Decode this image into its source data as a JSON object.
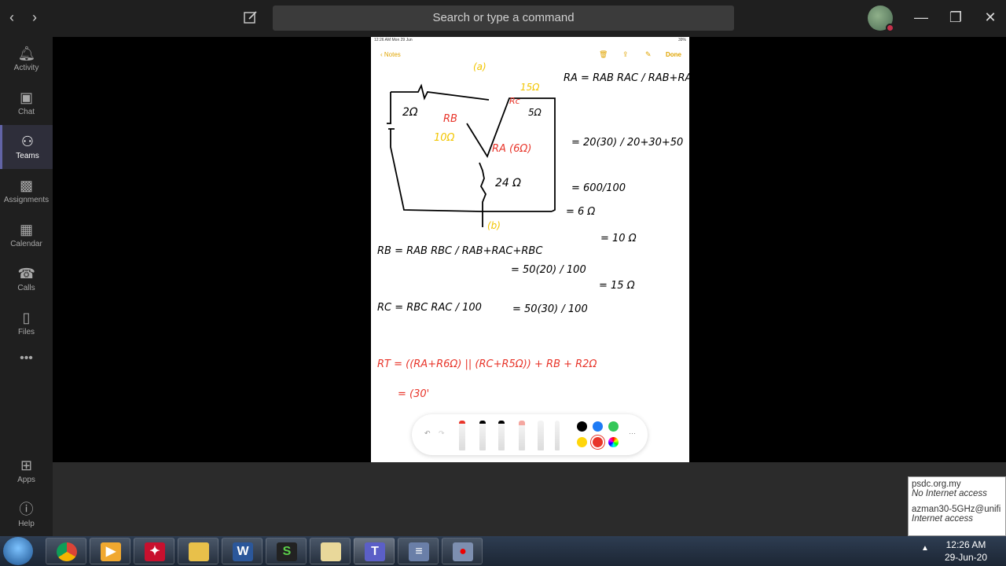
{
  "titlebar": {
    "back_icon": "chevron-left-icon",
    "forward_icon": "chevron-right-icon",
    "search_placeholder": "Search or type a command",
    "minimize": "—",
    "restore": "❐",
    "close": "✕"
  },
  "rail": {
    "items": [
      {
        "label": "Activity",
        "icon": "bell-icon"
      },
      {
        "label": "Chat",
        "icon": "chat-icon"
      },
      {
        "label": "Teams",
        "icon": "teams-icon",
        "active": true
      },
      {
        "label": "Assignments",
        "icon": "bag-icon"
      },
      {
        "label": "Calendar",
        "icon": "calendar-icon"
      },
      {
        "label": "Calls",
        "icon": "phone-icon"
      },
      {
        "label": "Files",
        "icon": "file-icon"
      },
      {
        "label": "•••",
        "icon": "more-icon"
      },
      {
        "label": "Apps",
        "icon": "apps-icon"
      },
      {
        "label": "Help",
        "icon": "help-icon"
      }
    ]
  },
  "ipad": {
    "status_time": "12:26 AM   Mon 29 Jun",
    "status_battery": "39%",
    "back_label": "Notes",
    "done_label": "Done",
    "notes": {
      "ra_formula": "RA = RAB RAC / RAB+RAC+RBC",
      "ra_step1": "= 20(30) / 20+30+50",
      "ra_step2": "= 600/100",
      "ra_result": "= 6 Ω",
      "rb_formula": "RB = RAB RBC / RAB+RAC+RBC",
      "rb_step": "= 50(20) / 100",
      "rb_result": "= 10 Ω",
      "rc_formula": "RC = RBC RAC / 100",
      "rc_step": "= 50(30) / 100",
      "rc_result": "= 15 Ω",
      "rt_formula": "RT = ((RA+R6Ω) || (RC+R5Ω)) + RB + R2Ω",
      "rt_step": "= (30'"
    }
  },
  "tooltip": {
    "site": "psdc.org.my",
    "site_status": "No Internet access",
    "wifi": "azman30-5GHz@unifi",
    "wifi_status": "Internet access"
  },
  "taskbar": {
    "apps": [
      "chrome",
      "media-player",
      "acrobat",
      "file-explorer",
      "word",
      "s-app",
      "notes",
      "teams",
      "task-manager",
      "recorder"
    ],
    "time": "12:26 AM",
    "date": "29-Jun-20"
  },
  "colors": {
    "accent": "#6264a7",
    "notes_yellow": "#e0a400",
    "ink_red": "#e8352a",
    "ink_yellow": "#f2c500"
  }
}
